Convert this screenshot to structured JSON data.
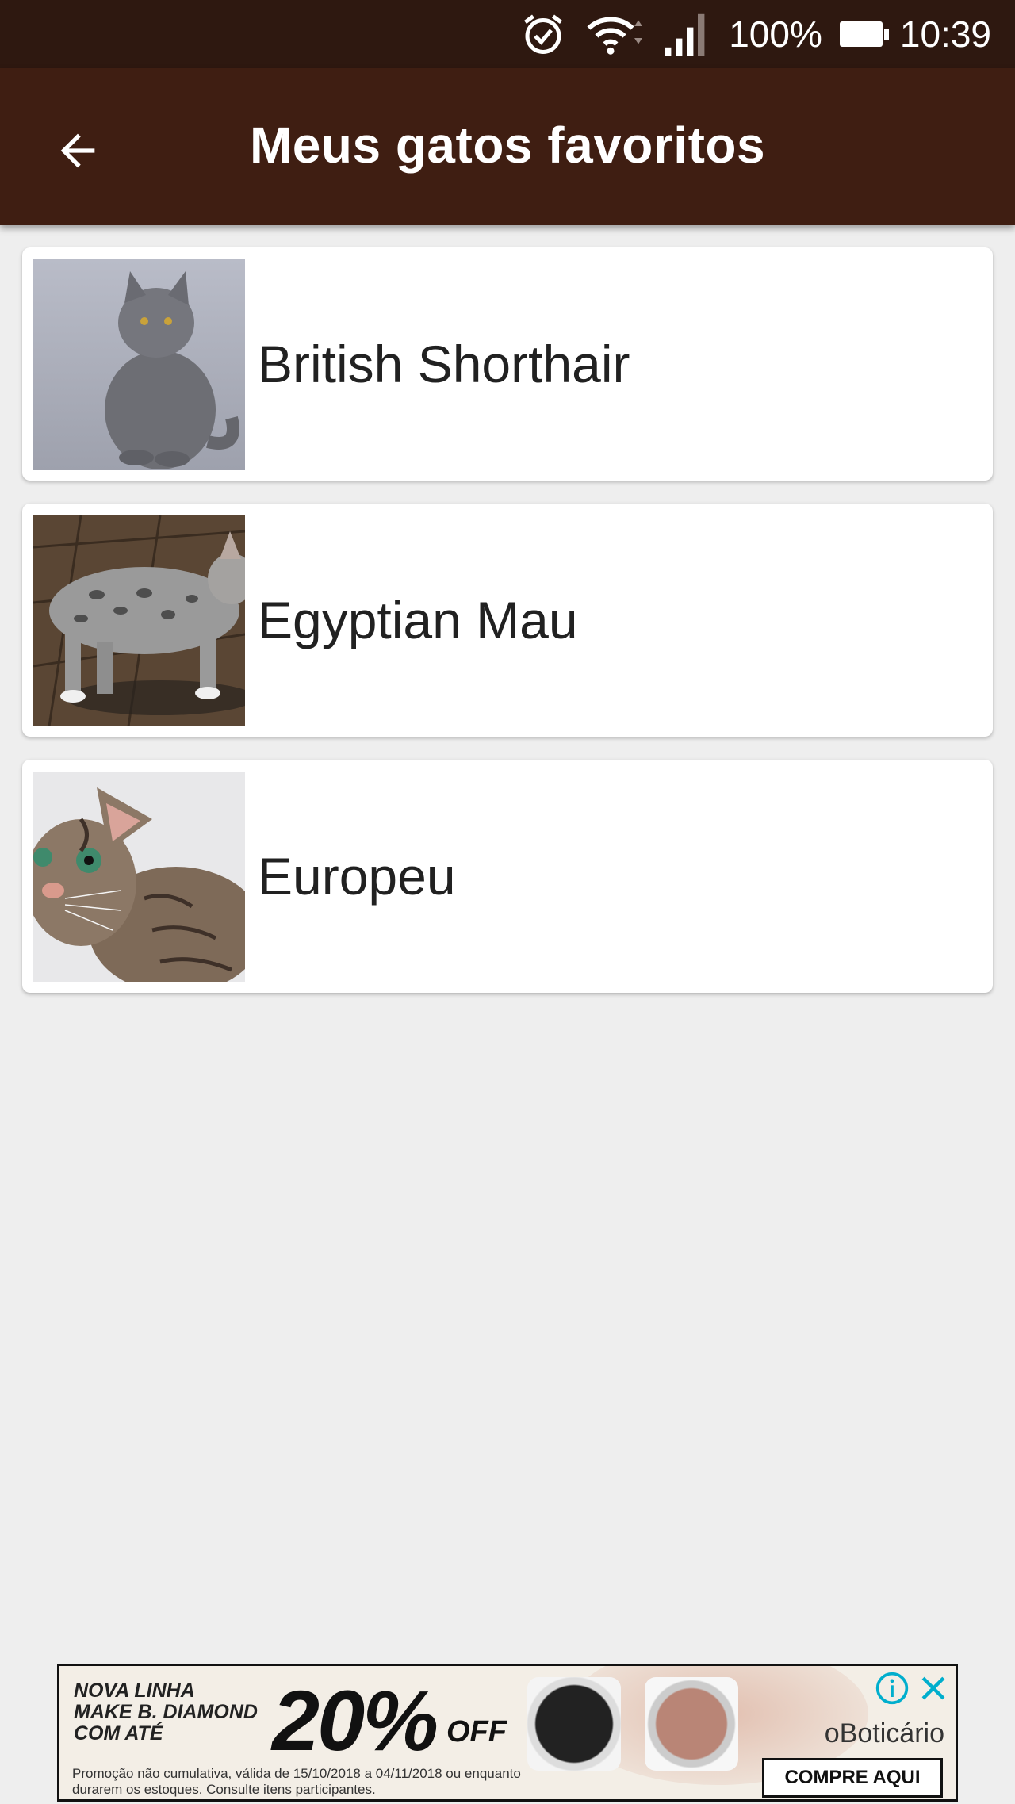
{
  "status_bar": {
    "battery_percent": "100%",
    "time": "10:39",
    "icons": [
      "alarm-icon",
      "wifi-icon",
      "signal-icon",
      "battery-icon"
    ]
  },
  "app_bar": {
    "title": "Meus gatos favoritos",
    "back_icon": "arrow-back-icon",
    "background": "#3f1e12"
  },
  "cats": [
    {
      "name": "British Shorthair"
    },
    {
      "name": "Egyptian Mau"
    },
    {
      "name": "Europeu"
    }
  ],
  "ad": {
    "promo_line1": "NOVA LINHA",
    "promo_line2": "MAKE B. DIAMOND",
    "promo_line3": "COM ATÉ",
    "percent": "20%",
    "off": "OFF",
    "fine_print": "Promoção não cumulativa, válida de 15/10/2018 a 04/11/2018 ou enquanto durarem os estoques. Consulte itens participantes.",
    "brand": "oBoticário",
    "cta": "COMPRE AQUI"
  }
}
